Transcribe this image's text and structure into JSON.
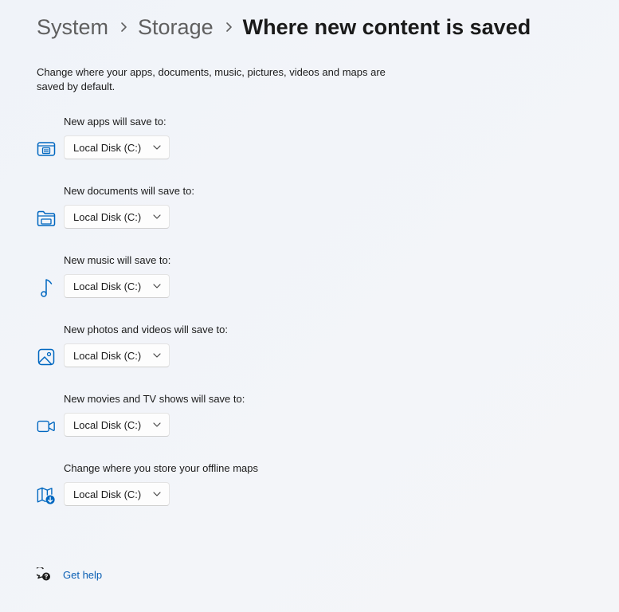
{
  "breadcrumb": {
    "items": [
      "System",
      "Storage"
    ],
    "current": "Where new content is saved"
  },
  "description": "Change where your apps, documents, music, pictures, videos and maps are saved by default.",
  "settings": [
    {
      "label": "New apps will save to:",
      "value": "Local Disk (C:)",
      "icon": "apps-icon"
    },
    {
      "label": "New documents will save to:",
      "value": "Local Disk (C:)",
      "icon": "documents-folder-icon"
    },
    {
      "label": "New music will save to:",
      "value": "Local Disk (C:)",
      "icon": "music-note-icon"
    },
    {
      "label": "New photos and videos will save to:",
      "value": "Local Disk (C:)",
      "icon": "photo-icon"
    },
    {
      "label": "New movies and TV shows will save to:",
      "value": "Local Disk (C:)",
      "icon": "video-camera-icon"
    },
    {
      "label": "Change where you store your offline maps",
      "value": "Local Disk (C:)",
      "icon": "map-download-icon"
    }
  ],
  "help": {
    "label": "Get help",
    "icon": "help-chat-icon"
  },
  "colors": {
    "accent": "#0067c0",
    "link": "#0a5fb4",
    "background": "#f3f5f9"
  }
}
